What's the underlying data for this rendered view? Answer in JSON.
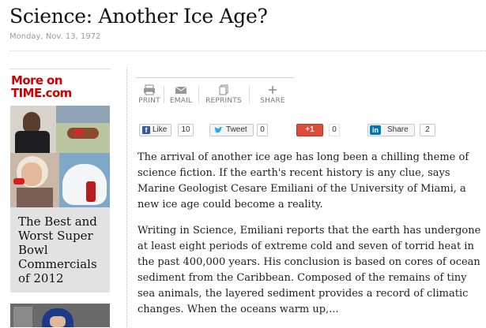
{
  "article": {
    "title": "Science: Another Ice Age?",
    "date": "Monday, Nov. 13, 1972",
    "paragraphs": [
      "The arrival of another ice age has long been a chilling theme of science fiction. If the earth's recent history is any clue, says Marine Geologist Cesare Emiliani of the University of Miami, a new ice age could become a reality.",
      "Writing in Science, Emiliani reports that the earth has undergone at least eight periods of extreme cold and seven of torrid heat in the past 400,000 years. His conclusion is based on cores of ocean sediment from the Caribbean. Composed of the remains of tiny sea animals, the layered sediment provides a record of climatic changes. When the oceans warm up,..."
    ]
  },
  "sidebar": {
    "heading_line1": "More on",
    "heading_line2": "TIME.com",
    "promo_caption": "The Best and Worst Super Bowl Commercials of 2012"
  },
  "tools": {
    "print": "PRINT",
    "email": "EMAIL",
    "reprints": "REPRINTS",
    "share": "SHARE"
  },
  "social": {
    "like_label": "Like",
    "like_count": "10",
    "tweet_label": "Tweet",
    "tweet_count": "0",
    "plusone_label": "+1",
    "plusone_count": "0",
    "linkedin_label": "Share",
    "linkedin_count": "2"
  },
  "colors": {
    "brand_red": "#cc0000",
    "facebook_blue": "#3b5998",
    "twitter_blue": "#2aa9e0",
    "google_red": "#dd4b39",
    "linkedin_blue": "#0077b5"
  }
}
